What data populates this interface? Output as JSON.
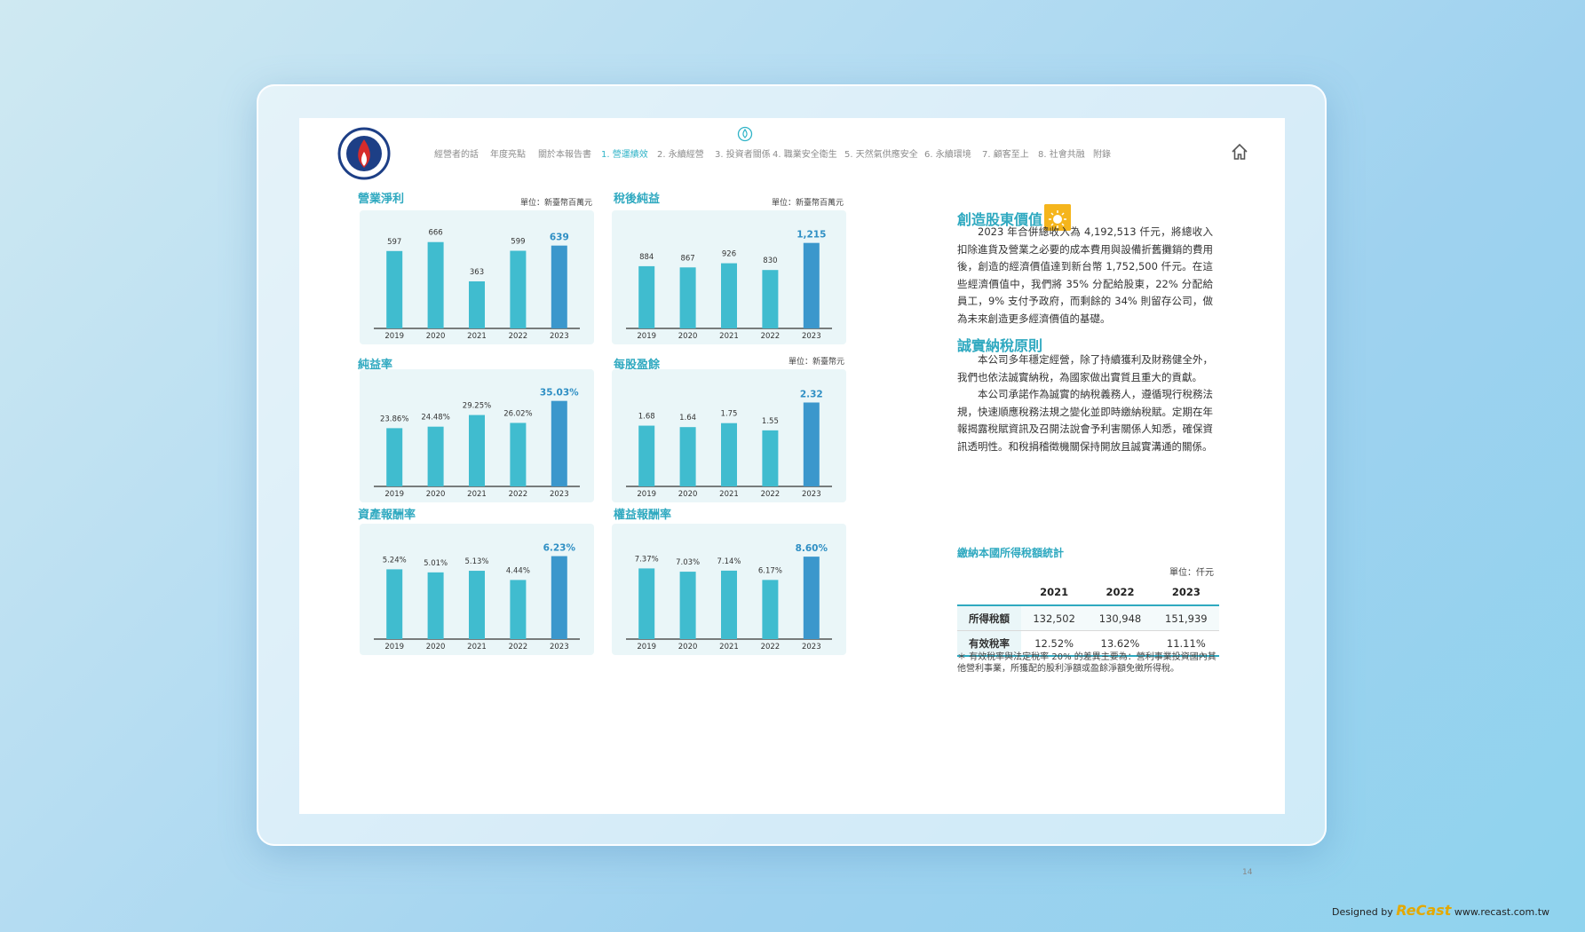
{
  "nav": {
    "items": [
      "經營者的話",
      "年度亮點",
      "關於本報告書",
      "1. 營運績效",
      "2. 永續經營",
      "3. 投資者關係",
      "4. 職業安全衛生",
      "5. 天然氣供應安全",
      "6. 永續環境",
      "7. 顧客至上",
      "8. 社會共融",
      "附錄"
    ],
    "active_index": 3
  },
  "charts": {
    "operating_profit": {
      "title": "營業淨利",
      "unit": "單位：新臺幣百萬元"
    },
    "net_income": {
      "title": "稅後純益",
      "unit": "單位：新臺幣百萬元"
    },
    "margin": {
      "title": "純益率",
      "unit": ""
    },
    "eps": {
      "title": "每股盈餘",
      "unit": "單位：新臺幣元"
    },
    "roa": {
      "title": "資產報酬率",
      "unit": ""
    },
    "roe": {
      "title": "權益報酬率",
      "unit": ""
    }
  },
  "chart_data": [
    {
      "type": "bar",
      "categories": [
        "2019",
        "2020",
        "2021",
        "2022",
        "2023"
      ],
      "values": [
        597,
        666,
        363,
        599,
        639
      ],
      "labels": [
        "597",
        "666",
        "363",
        "599",
        "639"
      ],
      "highlight_index": 4,
      "ylim": [
        0,
        760
      ]
    },
    {
      "type": "bar",
      "categories": [
        "2019",
        "2020",
        "2021",
        "2022",
        "2023"
      ],
      "values": [
        884,
        867,
        926,
        830,
        1215
      ],
      "labels": [
        "884",
        "867",
        "926",
        "830",
        "1,215"
      ],
      "highlight_index": 4,
      "ylim": [
        0,
        1400
      ]
    },
    {
      "type": "bar",
      "categories": [
        "2019",
        "2020",
        "2021",
        "2022",
        "2023"
      ],
      "values": [
        23.86,
        24.48,
        29.25,
        26.02,
        35.03
      ],
      "labels": [
        "23.86%",
        "24.48%",
        "29.25%",
        "26.02%",
        "35.03%"
      ],
      "highlight_index": 4,
      "ylim": [
        0,
        40
      ]
    },
    {
      "type": "bar",
      "categories": [
        "2019",
        "2020",
        "2021",
        "2022",
        "2023"
      ],
      "values": [
        1.68,
        1.64,
        1.75,
        1.55,
        2.32
      ],
      "labels": [
        "1.68",
        "1.64",
        "1.75",
        "1.55",
        "2.32"
      ],
      "highlight_index": 4,
      "ylim": [
        0,
        2.7
      ]
    },
    {
      "type": "bar",
      "categories": [
        "2019",
        "2020",
        "2021",
        "2022",
        "2023"
      ],
      "values": [
        5.24,
        5.01,
        5.13,
        4.44,
        6.23
      ],
      "labels": [
        "5.24%",
        "5.01%",
        "5.13%",
        "4.44%",
        "6.23%"
      ],
      "highlight_index": 4,
      "ylim": [
        0,
        7.2
      ]
    },
    {
      "type": "bar",
      "categories": [
        "2019",
        "2020",
        "2021",
        "2022",
        "2023"
      ],
      "values": [
        7.37,
        7.03,
        7.14,
        6.17,
        8.6
      ],
      "labels": [
        "7.37%",
        "7.03%",
        "7.14%",
        "6.17%",
        "8.60%"
      ],
      "highlight_index": 4,
      "ylim": [
        0,
        10
      ]
    }
  ],
  "colors": {
    "bar": "#40bccf",
    "highlight": "#3b97cc",
    "accent": "#2fa9c0"
  },
  "right": {
    "sec1_title": "創造股東價值",
    "sec1_para": "2023 年合併總收入為 4,192,513 仟元，將總收入扣除進貨及營業之必要的成本費用與設備折舊攤銷的費用後，創造的經濟價值達到新台幣 1,752,500 仟元。在這些經濟價值中，我們將 35% 分配給股東，22% 分配給員工，9% 支付予政府，而剩餘的 34% 則留存公司，做為未來創造更多經濟價值的基礎。",
    "sec2_title": "誠實納稅原則",
    "sec2_para1": "本公司多年穩定經營，除了持續獲利及財務健全外，我們也依法誠實納稅，為國家做出實質且重大的貢獻。",
    "sec2_para2": "本公司承諾作為誠實的納稅義務人，遵循現行稅務法規，快速順應稅務法規之變化並即時繳納稅賦。定期在年報揭露稅賦資訊及召開法說會予利害關係人知悉，確保資訊透明性。和稅捐稽徵機關保持開放且誠實溝通的關係。",
    "tax_title": "繳納本國所得稅額統計",
    "tax_unit": "單位：仟元",
    "tax_headers": [
      "2021",
      "2022",
      "2023"
    ],
    "tax_row1_label": "所得稅額",
    "tax_row1": [
      "132,502",
      "130,948",
      "151,939"
    ],
    "tax_row2_label": "有效稅率",
    "tax_row2": [
      "12.52%",
      "13.62%",
      "11.11%"
    ],
    "tax_note": "＊ 有效稅率與法定稅率 20% 的差異主要為：營利事業投資國內其他營利事業，所獲配的股利淨額或盈餘淨額免徵所得稅。"
  },
  "page_number": "14",
  "credit": {
    "designed_by": "Designed by",
    "brand": "ReCast",
    "url": "www.recast.com.tw"
  }
}
